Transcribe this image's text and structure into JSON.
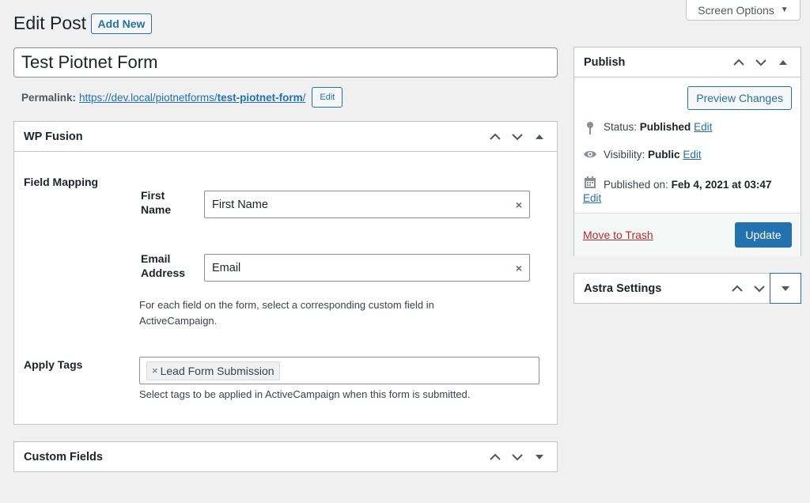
{
  "screen_options": {
    "label": "Screen Options",
    "caret": "▼"
  },
  "header": {
    "title": "Edit Post",
    "add_new": "Add New"
  },
  "post": {
    "title": "Test Piotnet Form",
    "permalink_label": "Permalink:",
    "permalink_base": "https://dev.local/piotnetforms/",
    "permalink_slug": "test-piotnet-form",
    "permalink_trailing": "/",
    "permalink_edit": "Edit"
  },
  "wpfusion": {
    "title": "WP Fusion",
    "field_mapping_label": "Field Mapping",
    "fields": [
      {
        "label_line1": "First",
        "label_line2": "Name",
        "value": "First Name",
        "clear": "×"
      },
      {
        "label_line1": "Email",
        "label_line2": "Address",
        "value": "Email",
        "clear": "×"
      }
    ],
    "mapping_desc_line1": "For each field on the form, select a corresponding custom field in",
    "mapping_desc_line2": "ActiveCampaign.",
    "apply_tags_label": "Apply Tags",
    "tag": {
      "remove": "×",
      "label": "Lead Form Submission"
    },
    "tags_desc": "Select tags to be applied in ActiveCampaign when this form is submitted."
  },
  "custom_fields": {
    "title": "Custom Fields"
  },
  "publish": {
    "title": "Publish",
    "preview": "Preview Changes",
    "status_label": "Status:",
    "status_value": "Published",
    "status_edit": "Edit",
    "visibility_label": "Visibility:",
    "visibility_value": "Public",
    "visibility_edit": "Edit",
    "published_label": "Published on:",
    "published_value": "Feb 4, 2021 at 03:47",
    "published_edit": "Edit",
    "trash": "Move to Trash",
    "update": "Update"
  },
  "astra": {
    "title": "Astra Settings"
  },
  "colors": {
    "accent": "#2271b1",
    "danger": "#b32d2e",
    "background": "#f0f0f1"
  }
}
